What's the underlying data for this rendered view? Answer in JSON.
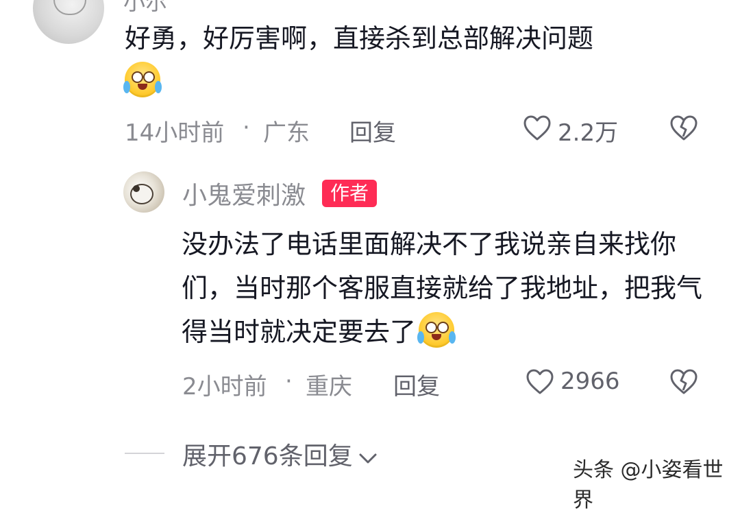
{
  "comment1": {
    "username": "小尔",
    "text": "好勇，好厉害啊，直接杀到总部解决问题",
    "emoji": "crying-laughing-emoji",
    "time": "14小时前",
    "sep": "·",
    "location": "广东",
    "reply_label": "回复",
    "like_count": "2.2万"
  },
  "comment2": {
    "username": "小鬼爱刺激",
    "badge": "作者",
    "text": "没办法了电话里面解决不了我说亲自来找你们，当时那个客服直接就给了我地址，把我气得当时就决定要去了",
    "emoji": "crying-laughing-emoji",
    "time": "2小时前",
    "sep": "·",
    "location": "重庆",
    "reply_label": "回复",
    "like_count": "2966"
  },
  "expand_label": "展开676条回复",
  "watermark": "头条 @小姿看世界",
  "colors": {
    "badge": "#fe2c55",
    "meta": "#8a8b91",
    "text": "#161823"
  }
}
